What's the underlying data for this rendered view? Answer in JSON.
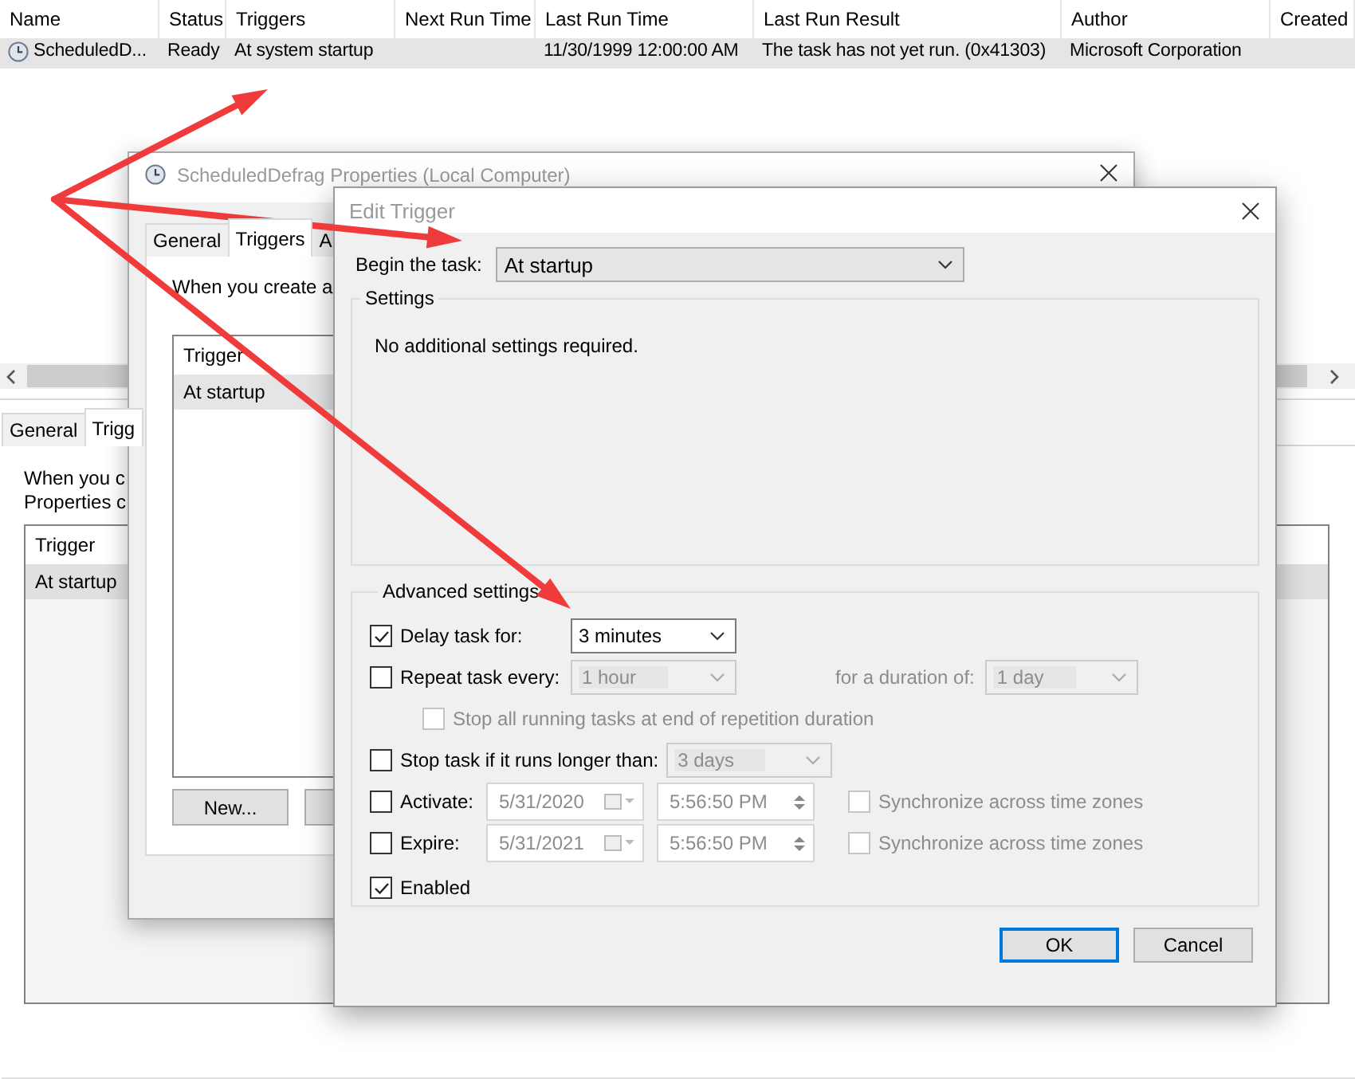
{
  "task_list": {
    "columns": [
      "Name",
      "Status",
      "Triggers",
      "Next Run Time",
      "Last Run Time",
      "Last Run Result",
      "Author",
      "Created"
    ],
    "rows": [
      {
        "name": "ScheduledD...",
        "status": "Ready",
        "triggers": "At system startup",
        "last_run_time": "11/30/1999 12:00:00 AM",
        "last_run_result": "The task has not yet run. (0x41303)",
        "author": "Microsoft Corporation",
        "selected": true
      }
    ]
  },
  "bottom_pane": {
    "tabs": [
      {
        "label": "General",
        "selected": false
      },
      {
        "label": "Trigg",
        "selected": true
      }
    ],
    "description": [
      "When you c",
      "Properties c"
    ],
    "trigger_list": {
      "header": "Trigger",
      "rows": [
        {
          "label": "At startup",
          "selected": true
        }
      ]
    }
  },
  "properties_dialog": {
    "title": "ScheduledDefrag Properties (Local Computer)",
    "tabs": [
      {
        "label": "General",
        "selected": false
      },
      {
        "label": "Triggers",
        "selected": true
      },
      {
        "label": "A",
        "selected": false
      }
    ],
    "description": "When you create a",
    "trigger_list": {
      "header": "Trigger",
      "rows": [
        {
          "label": "At startup",
          "selected": true
        }
      ]
    },
    "buttons": [
      "New..."
    ]
  },
  "edit_trigger": {
    "title": "Edit Trigger",
    "begin_label": "Begin the task:",
    "begin_value": "At startup",
    "settings": {
      "title": "Settings",
      "text": "No additional settings required."
    },
    "advanced": {
      "title": "Advanced settings",
      "rows": [
        {
          "kind": "select",
          "label": "Delay task for:",
          "checked": true,
          "value": "3 minutes",
          "disabled": false
        },
        {
          "kind": "select",
          "label": "Repeat task every:",
          "checked": false,
          "value": "1 hour",
          "disabled": true,
          "extra_label": "for a duration of:",
          "extra_value": "1 day"
        },
        {
          "kind": "sub",
          "label": "Stop all running tasks at end of repetition duration",
          "checked": false,
          "disabled": true
        },
        {
          "kind": "select",
          "label": "Stop task if it runs longer than:",
          "checked": false,
          "value": "3 days",
          "disabled": true
        },
        {
          "kind": "datetime",
          "label": "Activate:",
          "checked": false,
          "date": "5/31/2020",
          "time": "5:56:50 PM",
          "sync_label": "Synchronize across time zones",
          "sync_checked": false
        },
        {
          "kind": "datetime",
          "label": "Expire:",
          "checked": false,
          "date": "5/31/2021",
          "time": "5:56:50 PM",
          "sync_label": "Synchronize across time zones",
          "sync_checked": false
        },
        {
          "kind": "check",
          "label": "Enabled",
          "checked": true
        }
      ]
    },
    "buttons": [
      {
        "label": "OK",
        "default": true
      },
      {
        "label": "Cancel",
        "default": false
      }
    ]
  }
}
